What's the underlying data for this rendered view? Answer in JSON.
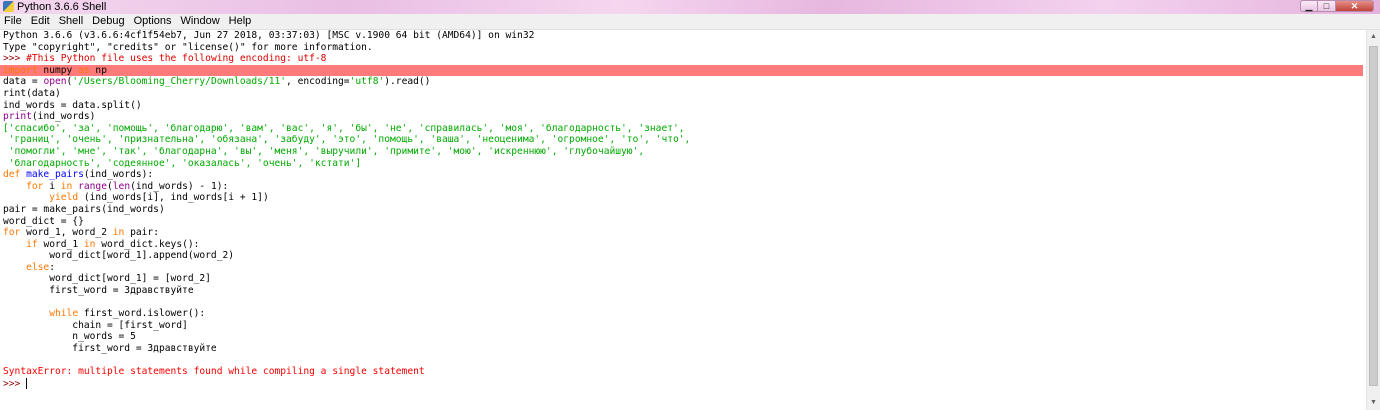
{
  "window": {
    "title": "Python 3.6.6 Shell",
    "min_glyph": "▁",
    "max_glyph": "□",
    "close_glyph": "✕"
  },
  "menu": [
    "File",
    "Edit",
    "Shell",
    "Debug",
    "Options",
    "Window",
    "Help"
  ],
  "scrollbar": {
    "up_glyph": "▲",
    "down_glyph": "▼"
  },
  "lines": [
    {
      "segs": [
        {
          "t": "Python 3.6.6 (v3.6.6:4cf1f54eb7, Jun 27 2018, 03:37:03) [MSC v.1900 64 bit (AMD64)] on win32",
          "c": ""
        }
      ]
    },
    {
      "segs": [
        {
          "t": "Type \"copyright\", \"credits\" or \"license()\" for more information.",
          "c": ""
        }
      ]
    },
    {
      "segs": [
        {
          "t": ">>> ",
          "c": "c-prompt"
        },
        {
          "t": "#This Python file uses the following encoding: utf-8",
          "c": "c-cmt"
        }
      ]
    },
    {
      "hl": true,
      "segs": [
        {
          "t": "import",
          "c": "c-kw"
        },
        {
          "t": " numpy ",
          "c": ""
        },
        {
          "t": "as",
          "c": "c-kw"
        },
        {
          "t": " np",
          "c": ""
        }
      ]
    },
    {
      "segs": [
        {
          "t": "data = ",
          "c": ""
        },
        {
          "t": "open",
          "c": "c-bi"
        },
        {
          "t": "(",
          "c": ""
        },
        {
          "t": "'/Users/Blooming_Cherry/Downloads/11'",
          "c": "c-str"
        },
        {
          "t": ", encoding=",
          "c": ""
        },
        {
          "t": "'utf8'",
          "c": "c-str"
        },
        {
          "t": ").read()",
          "c": ""
        }
      ]
    },
    {
      "segs": [
        {
          "t": "rint(data)",
          "c": ""
        }
      ]
    },
    {
      "segs": [
        {
          "t": "ind_words = data.split()",
          "c": ""
        }
      ]
    },
    {
      "segs": [
        {
          "t": "print",
          "c": "c-bi"
        },
        {
          "t": "(ind_words)",
          "c": ""
        }
      ]
    },
    {
      "segs": [
        {
          "t": "['спасибо', 'за', 'помощь', 'благодарю', 'вам', 'вас', 'я', 'бы', 'не', 'справилась', 'моя', 'благодарность', 'знает',",
          "c": "c-str"
        }
      ]
    },
    {
      "segs": [
        {
          "t": " 'границ', 'очень', 'признательна', 'обязана', 'забуду', 'это', 'помощь', 'ваша', 'неоценима', 'огромное', 'то', 'что',",
          "c": "c-str"
        }
      ]
    },
    {
      "segs": [
        {
          "t": " 'помогли', 'мне', 'так', 'благодарна', 'вы', 'меня', 'выручили', 'примите', 'мою', 'искреннюю', 'глубочайшую',",
          "c": "c-str"
        }
      ]
    },
    {
      "segs": [
        {
          "t": " 'благодарность', 'содеянное', 'оказалась', 'очень', 'кстати']",
          "c": "c-str"
        }
      ]
    },
    {
      "segs": [
        {
          "t": "def",
          "c": "c-kw"
        },
        {
          "t": " ",
          "c": ""
        },
        {
          "t": "make_pairs",
          "c": "c-def"
        },
        {
          "t": "(ind_words):",
          "c": ""
        }
      ]
    },
    {
      "segs": [
        {
          "t": "    ",
          "c": ""
        },
        {
          "t": "for",
          "c": "c-kw"
        },
        {
          "t": " i ",
          "c": ""
        },
        {
          "t": "in",
          "c": "c-kw"
        },
        {
          "t": " ",
          "c": ""
        },
        {
          "t": "range",
          "c": "c-bi"
        },
        {
          "t": "(",
          "c": ""
        },
        {
          "t": "len",
          "c": "c-bi"
        },
        {
          "t": "(ind_words) - 1):",
          "c": ""
        }
      ]
    },
    {
      "segs": [
        {
          "t": "        ",
          "c": ""
        },
        {
          "t": "yield",
          "c": "c-kw"
        },
        {
          "t": " (ind_words[i], ind_words[i + 1])",
          "c": ""
        }
      ]
    },
    {
      "segs": [
        {
          "t": "pair = make_pairs(ind_words)",
          "c": ""
        }
      ]
    },
    {
      "segs": [
        {
          "t": "word_dict = {}",
          "c": ""
        }
      ]
    },
    {
      "segs": [
        {
          "t": "for",
          "c": "c-kw"
        },
        {
          "t": " word_1, word_2 ",
          "c": ""
        },
        {
          "t": "in",
          "c": "c-kw"
        },
        {
          "t": " pair:",
          "c": ""
        }
      ]
    },
    {
      "segs": [
        {
          "t": "    ",
          "c": ""
        },
        {
          "t": "if",
          "c": "c-kw"
        },
        {
          "t": " word_1 ",
          "c": ""
        },
        {
          "t": "in",
          "c": "c-kw"
        },
        {
          "t": " word_dict.keys():",
          "c": ""
        }
      ]
    },
    {
      "segs": [
        {
          "t": "        word_dict[word_1].append(word_2)",
          "c": ""
        }
      ]
    },
    {
      "segs": [
        {
          "t": "    ",
          "c": ""
        },
        {
          "t": "else",
          "c": "c-kw"
        },
        {
          "t": ":",
          "c": ""
        }
      ]
    },
    {
      "segs": [
        {
          "t": "        word_dict[word_1] = [word_2]",
          "c": ""
        }
      ]
    },
    {
      "segs": [
        {
          "t": "        first_word = Здравствуйте",
          "c": ""
        }
      ]
    },
    {
      "segs": [
        {
          "t": "",
          "c": ""
        }
      ]
    },
    {
      "segs": [
        {
          "t": "        ",
          "c": ""
        },
        {
          "t": "while",
          "c": "c-kw"
        },
        {
          "t": " first_word.islower():",
          "c": ""
        }
      ]
    },
    {
      "segs": [
        {
          "t": "            chain = [first_word]",
          "c": ""
        }
      ]
    },
    {
      "segs": [
        {
          "t": "            n_words = 5",
          "c": ""
        }
      ]
    },
    {
      "segs": [
        {
          "t": "            first_word = Здравствуйте",
          "c": ""
        }
      ]
    },
    {
      "segs": [
        {
          "t": "",
          "c": ""
        }
      ]
    },
    {
      "segs": [
        {
          "t": "SyntaxError: multiple statements found while compiling a single statement",
          "c": "c-err"
        }
      ]
    },
    {
      "segs": [
        {
          "t": ">>> ",
          "c": "c-prompt"
        }
      ],
      "cursor": true
    }
  ]
}
